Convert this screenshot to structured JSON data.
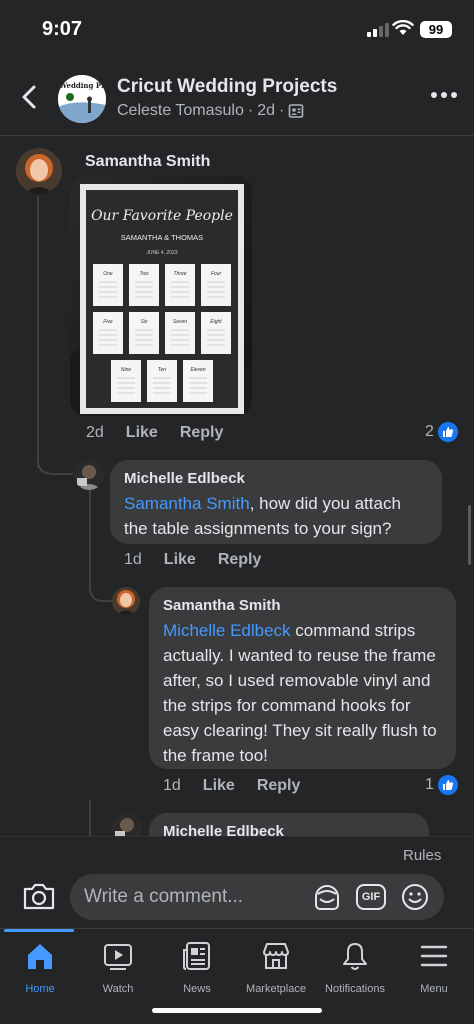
{
  "status_bar": {
    "time": "9:07",
    "battery": "99"
  },
  "header": {
    "group_name": "Cricut Wedding Projects",
    "author": "Celeste Tomasulo",
    "age": "2d",
    "separator": "·",
    "avatar_text": "Wedding Pr"
  },
  "comments": [
    {
      "name": "Samantha Smith",
      "photo": {
        "title": "Our Favorite People",
        "names": "SAMANTHA & THOMAS",
        "date": "JUNE 4, 2023",
        "cards": [
          "One",
          "Two",
          "Three",
          "Four",
          "Five",
          "Six",
          "Seven",
          "Eight",
          "Nine",
          "Ten",
          "Eleven"
        ]
      },
      "time": "2d",
      "like_label": "Like",
      "reply_label": "Reply",
      "reactions": "2"
    },
    {
      "name": "Michelle Edlbeck",
      "mention": "Samantha Smith",
      "text": ", how did you attach the table assignments to your sign?",
      "time": "1d",
      "like_label": "Like",
      "reply_label": "Reply"
    },
    {
      "name": "Samantha Smith",
      "mention": "Michelle Edlbeck",
      "text": " command strips actually. I wanted to reuse the frame after, so I used removable vinyl and the strips for command hooks for easy clearing! They sit really flush to the frame too!",
      "time": "1d",
      "like_label": "Like",
      "reply_label": "Reply",
      "reactions": "1"
    },
    {
      "name": "Michelle Edlbeck"
    }
  ],
  "composer": {
    "rules": "Rules",
    "placeholder": "Write a comment...",
    "gif": "GIF"
  },
  "nav": [
    {
      "label": "Home"
    },
    {
      "label": "Watch"
    },
    {
      "label": "News"
    },
    {
      "label": "Marketplace"
    },
    {
      "label": "Notifications"
    },
    {
      "label": "Menu"
    }
  ],
  "colors": {
    "background": "#242526",
    "bubble": "#3a3b3c",
    "accent": "#4599ff",
    "like": "#1877f2"
  }
}
